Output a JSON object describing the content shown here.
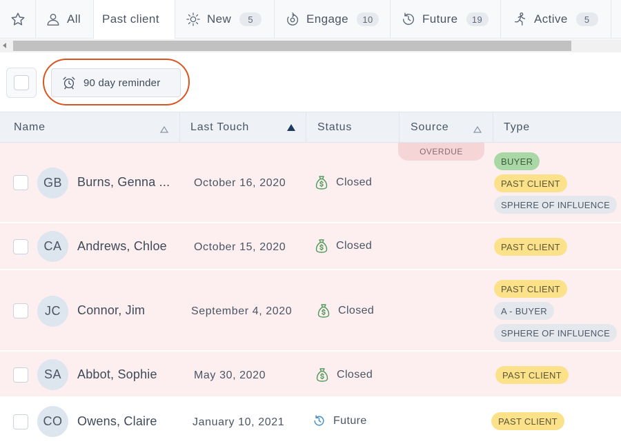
{
  "tabs": [
    {
      "label": "",
      "icon": "star-icon"
    },
    {
      "label": "All",
      "icon": "person-icon"
    },
    {
      "label": "Past client",
      "icon": ""
    },
    {
      "label": "New",
      "icon": "sun-icon",
      "count": "5"
    },
    {
      "label": "Engage",
      "icon": "engage-icon",
      "count": "10"
    },
    {
      "label": "Future",
      "icon": "history-clock-icon",
      "count": "19"
    },
    {
      "label": "Active",
      "icon": "running-person-icon",
      "count": "5"
    }
  ],
  "toolbar": {
    "reminder_label": "90 day reminder"
  },
  "table": {
    "columns": {
      "name": "Name",
      "last_touch": "Last Touch",
      "status": "Status",
      "source": "Source",
      "type": "Type"
    },
    "overdue_label": "OVERDUE",
    "rows": [
      {
        "initials": "GB",
        "name": "Burns, Genna ...",
        "date": "October 16, 2020",
        "status": "Closed",
        "tags": [
          "BUYER",
          "PAST CLIENT",
          "SPHERE OF INFLUENCE"
        ]
      },
      {
        "initials": "CA",
        "name": "Andrews, Chloe",
        "date": "October 15, 2020",
        "status": "Closed",
        "tags": [
          "PAST CLIENT"
        ]
      },
      {
        "initials": "JC",
        "name": "Connor, Jim",
        "date": "September 4, 2020",
        "status": "Closed",
        "tags": [
          "PAST CLIENT",
          "A - BUYER",
          "SPHERE OF INFLUENCE"
        ]
      },
      {
        "initials": "SA",
        "name": "Abbot, Sophie",
        "date": "May 30, 2020",
        "status": "Closed",
        "tags": [
          "PAST CLIENT"
        ]
      },
      {
        "initials": "CO",
        "name": "Owens, Claire",
        "date": "January 10, 2021",
        "status": "Future",
        "tags": [
          "PAST CLIENT"
        ]
      }
    ]
  },
  "colors": {
    "overdue_row": "#fdeff0",
    "tag_yellow": "#fbe28a",
    "tag_green": "#a9d8a6",
    "tag_gray": "#e4e8ed",
    "status_icon_green": "#4f9a5a",
    "future_icon_blue": "#3d8ec9",
    "highlight_ring": "#d9531e"
  }
}
